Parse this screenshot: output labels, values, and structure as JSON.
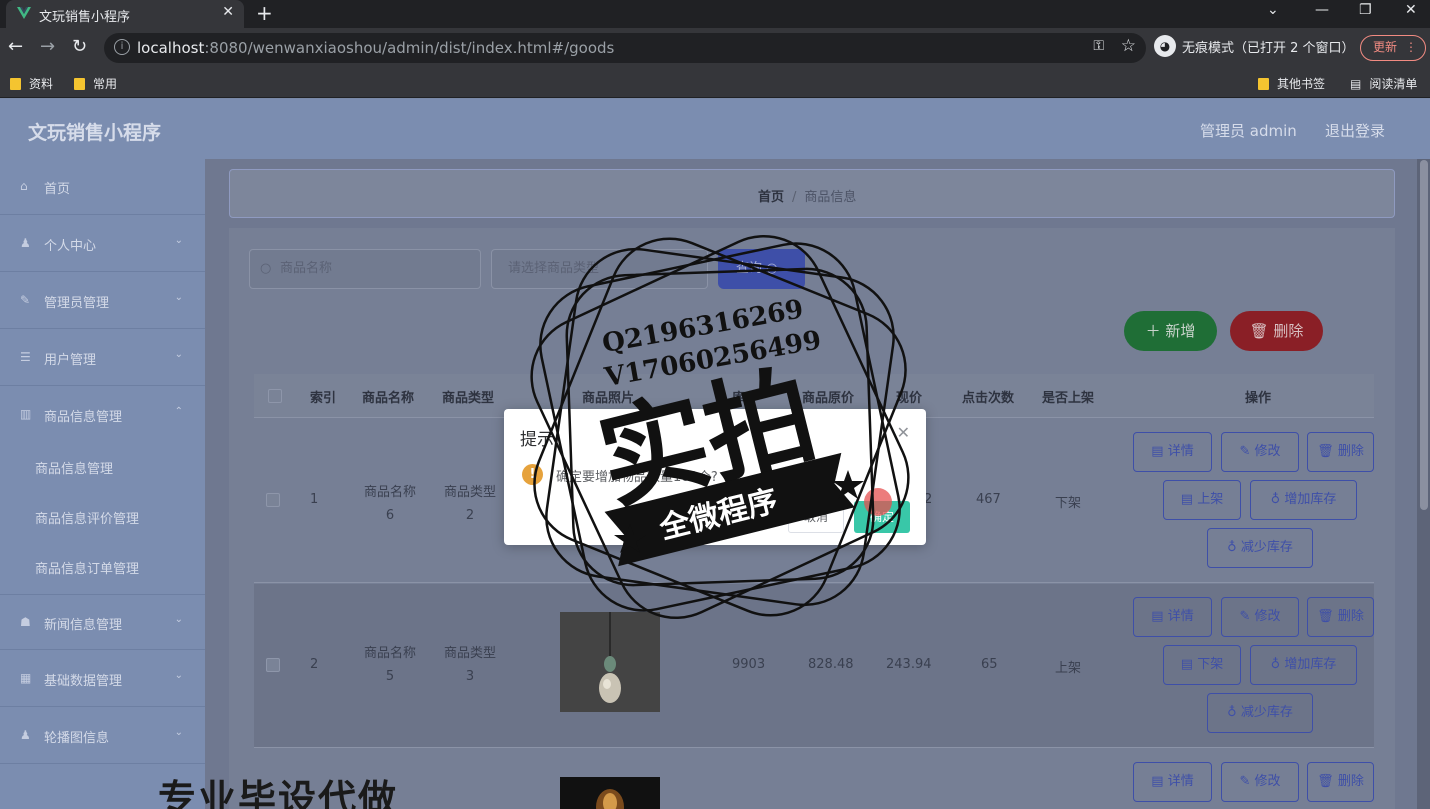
{
  "browser": {
    "tab_title": "文玩销售小程序",
    "url_host": "localhost",
    "url_rest": ":8080/wenwanxiaoshou/admin/dist/index.html#/goods",
    "incognito_label": "无痕模式（已打开 2 个窗口）",
    "update_label": "更新",
    "bookmarks": [
      "资料",
      "常用"
    ],
    "bookmarks_right": [
      "其他书签",
      "阅读清单"
    ]
  },
  "header": {
    "title": "文玩销售小程序",
    "admin_label": "管理员 admin",
    "logout_label": "退出登录"
  },
  "sidebar": {
    "items": [
      {
        "label": "首页",
        "icon": "home-icon"
      },
      {
        "label": "个人中心",
        "icon": "user-icon"
      },
      {
        "label": "管理员管理",
        "icon": "admin-icon"
      },
      {
        "label": "用户管理",
        "icon": "list-icon"
      },
      {
        "label": "商品信息管理",
        "icon": "chart-icon"
      },
      {
        "label": "新闻信息管理",
        "icon": "news-icon"
      },
      {
        "label": "基础数据管理",
        "icon": "grid-icon"
      },
      {
        "label": "轮播图信息",
        "icon": "user-icon"
      }
    ],
    "sub_items": [
      "商品信息管理",
      "商品信息评价管理",
      "商品信息订单管理"
    ]
  },
  "breadcrumb": {
    "home": "首页",
    "separator": "/",
    "current": "商品信息"
  },
  "search": {
    "name_placeholder": "商品名称",
    "type_placeholder": "请选择商品类型",
    "query_label": "查询"
  },
  "actions": {
    "add_label": "新增",
    "delete_label": "删除"
  },
  "table": {
    "headers": [
      "索引",
      "商品名称",
      "商品类型",
      "商品照片",
      "库存",
      "商品原价",
      "现价",
      "点击次数",
      "是否上架",
      "操作"
    ],
    "rows": [
      {
        "index": "1",
        "name": "商品名称 6",
        "type": "商品类型 2",
        "stock": "",
        "original": "",
        "price": "2",
        "clicks": "467",
        "status": "下架",
        "toggle_label": "上架"
      },
      {
        "index": "2",
        "name": "商品名称 5",
        "type": "商品类型 3",
        "stock": "9903",
        "original": "828.48",
        "price": "243.94",
        "clicks": "65",
        "status": "上架",
        "toggle_label": "下架"
      }
    ],
    "op_labels": {
      "detail": "详情",
      "edit": "修改",
      "delete": "删除",
      "add_stock": "增加库存",
      "reduce_stock": "减少库存"
    }
  },
  "dialog": {
    "title": "提示",
    "message": "确定要增加物品数量100个?",
    "cancel_label": "取消",
    "confirm_label": "确定"
  },
  "watermark": {
    "line1": "Q2196316269",
    "line2": "V17060256499",
    "big": "实拍",
    "ribbon": "全微程序",
    "bottom_banner": "专业毕设代做"
  },
  "colors": {
    "primary": "#3e4fa8",
    "success": "#1f6e36",
    "danger": "#8a1f26",
    "confirm": "#39c7a8",
    "warning": "#e6a23c"
  }
}
